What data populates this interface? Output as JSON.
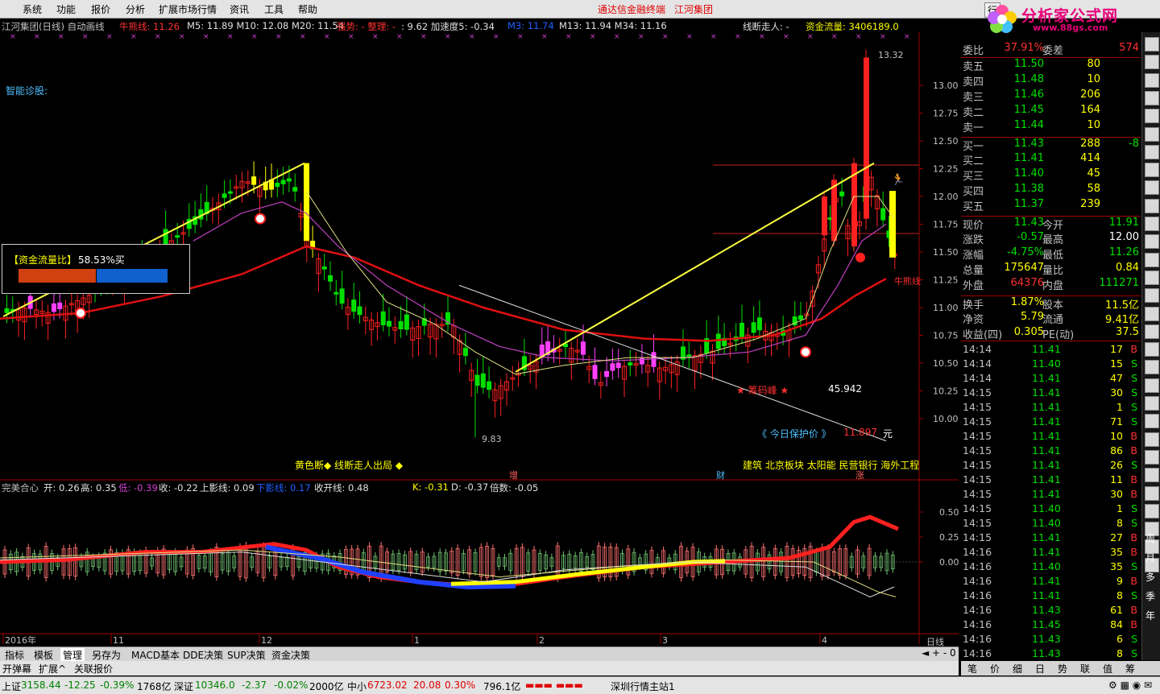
{
  "menu": {
    "items": [
      "系统",
      "功能",
      "报价",
      "分析",
      "扩展市场行情",
      "资讯",
      "工具",
      "帮助"
    ],
    "brand_center": "通达信金融终端",
    "brand_company": "江河集团",
    "right_button": "行"
  },
  "logo": {
    "title": "分析家公式网",
    "url": "www.88gs.com"
  },
  "chart_header": {
    "name": "江河集团(日线) 自动画线",
    "niuxian": "牛熊线: 11.26",
    "ma": "M5: 11.89  M10: 12.08  M20: 11.54",
    "qiangshi": "强势: - 整理: -",
    "s1": ": 9.62  加速度5: -0.34",
    "m3": "M3: 11.74",
    "m13": "M13: 11.94  M34: 11.16",
    "xianduan": "线断走人: -",
    "zijin": "资金流量: 3406189.0"
  },
  "chart_labels": {
    "diagnosis": "智能诊股:",
    "flow_ratio_label": "【资金流量比】",
    "flow_ratio_value": "58.53%买",
    "high_price": "13.32",
    "low_price": "9.83",
    "niuxian_tag": "牛熊线",
    "chips": "★ 筹码峰 ★",
    "chips_value": "45.942",
    "protect_label": "《 今日保护价 》",
    "protect_value": "11.897",
    "protect_unit": "元",
    "yellow_break": "黄色断◆ 线断走人出局 ◆",
    "sector_tags": "建筑 北京板块 太阳能 民营银行 海外工程",
    "mark_zeng": "增",
    "mark_cai": "财",
    "mark_zhang": "涨"
  },
  "y_axis_main": [
    "13.00",
    "12.75",
    "12.50",
    "12.25",
    "12.00",
    "11.75",
    "11.50",
    "11.25",
    "11.00",
    "10.75",
    "10.50",
    "10.25",
    "10.00"
  ],
  "y_axis_sub": [
    "0.50",
    "0.25",
    "0.00"
  ],
  "x_axis": {
    "labels": [
      "2016年",
      "11",
      "12",
      "1",
      "2",
      "3",
      "4"
    ],
    "period": "日线"
  },
  "sub_header": {
    "name": "完美合心",
    "open": "开: 0.26",
    "high": "高: 0.35",
    "low": "低: -0.39",
    "close": "收: -0.22",
    "upper": "上影线: 0.09",
    "lower": "下影线: 0.17",
    "shoukai": "收开线: 0.48",
    "k": "K: -0.31",
    "d": "D: -0.37",
    "beishu": "倍数: -0.05"
  },
  "quote": {
    "weibi": {
      "label": "委比",
      "v1": "37.91%",
      "label2": "委差",
      "v2": "574"
    },
    "sell": [
      {
        "label": "卖五",
        "price": "11.50",
        "vol": "80"
      },
      {
        "label": "卖四",
        "price": "11.48",
        "vol": "10"
      },
      {
        "label": "卖三",
        "price": "11.46",
        "vol": "206"
      },
      {
        "label": "卖二",
        "price": "11.45",
        "vol": "164"
      },
      {
        "label": "卖一",
        "price": "11.44",
        "vol": "10"
      }
    ],
    "buy": [
      {
        "label": "买一",
        "price": "11.43",
        "vol": "288",
        "chg": "-8"
      },
      {
        "label": "买二",
        "price": "11.41",
        "vol": "414",
        "chg": ""
      },
      {
        "label": "买三",
        "price": "11.40",
        "vol": "45",
        "chg": ""
      },
      {
        "label": "买四",
        "price": "11.38",
        "vol": "58",
        "chg": ""
      },
      {
        "label": "买五",
        "price": "11.37",
        "vol": "239",
        "chg": ""
      }
    ],
    "stats": [
      {
        "l1": "现价",
        "v1": "11.43",
        "c1": "grn",
        "l2": "今开",
        "v2": "11.91",
        "c2": "grn"
      },
      {
        "l1": "涨跌",
        "v1": "-0.57",
        "c1": "grn",
        "l2": "最高",
        "v2": "12.00",
        "c2": "wht"
      },
      {
        "l1": "涨幅",
        "v1": "-4.75%",
        "c1": "grn",
        "l2": "最低",
        "v2": "11.26",
        "c2": "grn"
      },
      {
        "l1": "总量",
        "v1": "175647",
        "c1": "yel",
        "l2": "量比",
        "v2": "0.84",
        "c2": "yel"
      },
      {
        "l1": "外盘",
        "v1": "64376",
        "c1": "red",
        "l2": "内盘",
        "v2": "111271",
        "c2": "grn"
      },
      {
        "l1": "换手",
        "v1": "1.87%",
        "c1": "yel",
        "l2": "股本",
        "v2": "11.5亿",
        "c2": "yel"
      },
      {
        "l1": "净资",
        "v1": "5.79",
        "c1": "yel",
        "l2": "流通",
        "v2": "9.41亿",
        "c2": "yel"
      },
      {
        "l1": "收益(四)",
        "v1": "0.305",
        "c1": "yel",
        "l2": "PE(动)",
        "v2": "37.5",
        "c2": "yel"
      }
    ]
  },
  "ticks": [
    {
      "t": "14:14",
      "p": "11.41",
      "v": "17",
      "bs": "B"
    },
    {
      "t": "14:14",
      "p": "11.40",
      "v": "15",
      "bs": "S"
    },
    {
      "t": "14:14",
      "p": "11.41",
      "v": "47",
      "bs": "S"
    },
    {
      "t": "14:15",
      "p": "11.41",
      "v": "30",
      "bs": "S"
    },
    {
      "t": "14:15",
      "p": "11.41",
      "v": "1",
      "bs": "S"
    },
    {
      "t": "14:15",
      "p": "11.41",
      "v": "71",
      "bs": "S"
    },
    {
      "t": "14:15",
      "p": "11.41",
      "v": "10",
      "bs": "B"
    },
    {
      "t": "14:15",
      "p": "11.41",
      "v": "86",
      "bs": "B"
    },
    {
      "t": "14:15",
      "p": "11.41",
      "v": "26",
      "bs": "S"
    },
    {
      "t": "14:15",
      "p": "11.41",
      "v": "11",
      "bs": "B"
    },
    {
      "t": "14:15",
      "p": "11.41",
      "v": "30",
      "bs": "B"
    },
    {
      "t": "14:15",
      "p": "11.40",
      "v": "1",
      "bs": "S"
    },
    {
      "t": "14:15",
      "p": "11.40",
      "v": "8",
      "bs": "S"
    },
    {
      "t": "14:15",
      "p": "11.41",
      "v": "27",
      "bs": "B"
    },
    {
      "t": "14:16",
      "p": "11.41",
      "v": "35",
      "bs": "B"
    },
    {
      "t": "14:16",
      "p": "11.40",
      "v": "35",
      "bs": "S"
    },
    {
      "t": "14:16",
      "p": "11.41",
      "v": "9",
      "bs": "B"
    },
    {
      "t": "14:16",
      "p": "11.41",
      "v": "8",
      "bs": "S"
    },
    {
      "t": "14:16",
      "p": "11.43",
      "v": "61",
      "bs": "B"
    },
    {
      "t": "14:16",
      "p": "11.45",
      "v": "84",
      "bs": "B"
    },
    {
      "t": "14:16",
      "p": "11.43",
      "v": "6",
      "bs": "S"
    },
    {
      "t": "14:16",
      "p": "11.43",
      "v": "8",
      "bs": "S"
    }
  ],
  "sidebar_vtext": [
    "周",
    "月",
    "多",
    "季",
    "年"
  ],
  "bottom_tabs": [
    "指标",
    "模板",
    "管理",
    "另存为",
    "MACD基本",
    "DDE决策",
    "SUP决策",
    "资金决策"
  ],
  "bottom_tabs2": [
    "开弹幕",
    "扩展^",
    "关联报价"
  ],
  "right_tabs": [
    "笔",
    "价",
    "细",
    "日",
    "势",
    "联",
    "值",
    "筹"
  ],
  "status": {
    "sh_label": "上证",
    "sh_val": "3158.44",
    "sh_chg": "-12.25",
    "sh_pct": "-0.39%",
    "sh_amt": "1768亿",
    "sz_label": "深证",
    "sz_val": "10346.0",
    "sz_chg": "-2.37",
    "sz_pct": "-0.02%",
    "sz_amt": "2000亿",
    "zx_label": "中小",
    "zx_val": "6723.02",
    "zx_chg": "20.08",
    "zx_pct": "0.30%",
    "zx_amt": "796.1亿",
    "server": "深圳行情主站1"
  },
  "colors": {
    "up": "#ff3030",
    "down": "#00e000",
    "ma_red": "#e01010",
    "yellow": "#ffff00",
    "magenta": "#d040d0",
    "blue": "#2040ff"
  }
}
